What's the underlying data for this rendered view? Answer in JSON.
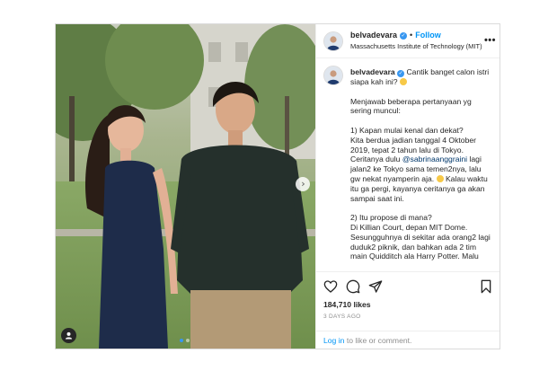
{
  "post": {
    "username": "belvadevara",
    "follow_label": "Follow",
    "separator": "•",
    "location": "Massachusetts Institute of Technology (MIT)",
    "more_label": "•••",
    "caption": {
      "username": "belvadevara",
      "intro": "Cantik banget calon istri siapa kah ini?",
      "p1": "Menjawab beberapa pertanyaan yg sering muncul:",
      "q1_title": "1) Kapan mulai kenal dan dekat?",
      "q1_a": "Kita berdua jadian tanggal 4 Oktober 2019, tepat 2 tahun lalu di Tokyo. Ceritanya dulu",
      "q1_mention": "@sabrinaanggraini",
      "q1_b": "lagi jalan2 ke Tokyo sama temen2nya, lalu gw nekat nyamperin aja.",
      "q1_c": "Kalau waktu itu ga pergi, kayanya ceritanya ga akan sampai saat ini.",
      "q2_title": "2) Itu propose di mana?",
      "q2_a": "Di Killian Court, depan MIT Dome. Sesungguhnya di sekitar ada orang2 lagi duduk2 piknik, dan bahkan ada 2 tim main Quidditch ala Harry Potter. Malu"
    },
    "likes": "184,710 likes",
    "date": "3 DAYS AGO",
    "login_link": "Log in",
    "login_rest": "to like or comment."
  },
  "icons": {
    "verified": "verified-badge-icon",
    "like": "heart-icon",
    "comment": "comment-icon",
    "share": "paper-plane-icon",
    "save": "bookmark-icon",
    "tag": "user-tag-icon",
    "next": "chevron-right-icon"
  },
  "colors": {
    "accent": "#0095f6",
    "verified": "#3897f0",
    "muted": "#8e8e8e",
    "border": "#dbdbdb"
  },
  "carousel": {
    "current": 1,
    "total": 2
  }
}
